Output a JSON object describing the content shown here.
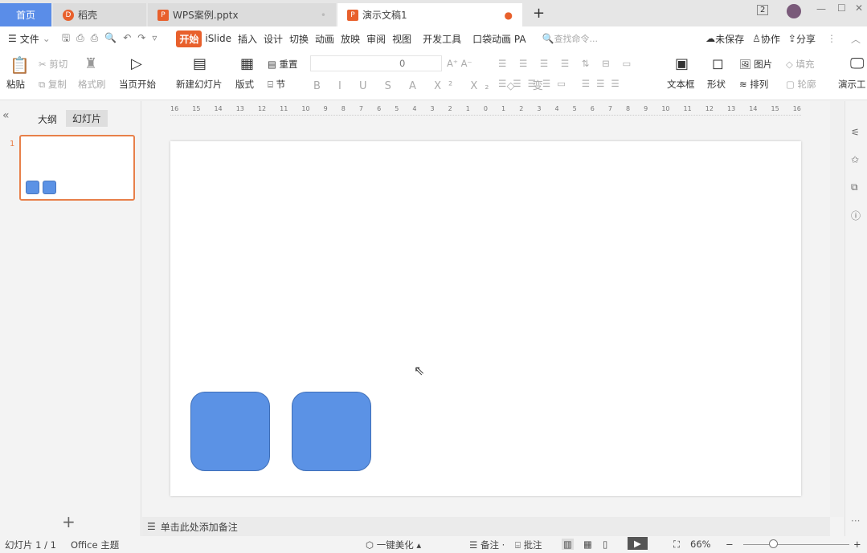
{
  "tabs": {
    "home": "首页",
    "daoke": "稻壳",
    "file1": "WPS案例.pptx",
    "file2": "演示文稿1",
    "new_tab": "+",
    "badge": "2"
  },
  "menu": {
    "file": "文件",
    "items": [
      "开始",
      "iSlide",
      "插入",
      "设计",
      "切换",
      "动画",
      "放映",
      "审阅",
      "视图",
      "开发工具",
      "口袋动画 PA"
    ],
    "search_placeholder": "查找命令...",
    "unsaved": "未保存",
    "collab": "协作",
    "share": "分享"
  },
  "ribbon": {
    "paste": "粘贴",
    "cut": "剪切",
    "copy": "复制",
    "format_painter": "格式刷",
    "play_from_current": "当页开始",
    "new_slide": "新建幻灯片",
    "layout": "版式",
    "reset": "重置",
    "section": "节",
    "font_size": "0",
    "textbox": "文本框",
    "shape": "形状",
    "picture": "图片",
    "fill": "填充",
    "arrange": "排列",
    "outline": "轮廓",
    "present_tools": "演示工"
  },
  "panel": {
    "outline_tab": "大纲",
    "slides_tab": "幻灯片",
    "slide_number": "1",
    "add": "+"
  },
  "ruler": [
    "16",
    "15",
    "14",
    "13",
    "12",
    "11",
    "10",
    "9",
    "8",
    "7",
    "6",
    "5",
    "4",
    "3",
    "2",
    "1",
    "0",
    "1",
    "2",
    "3",
    "4",
    "5",
    "6",
    "7",
    "8",
    "9",
    "10",
    "11",
    "12",
    "13",
    "14",
    "15",
    "16"
  ],
  "notes": {
    "placeholder": "单击此处添加备注"
  },
  "status": {
    "slide": "幻灯片 1 / 1",
    "theme": "Office 主题",
    "beautify": "一键美化",
    "notes": "备注",
    "comment": "批注",
    "zoom": "66%"
  },
  "colors": {
    "accent": "#e8602c",
    "shape": "#5b92e5",
    "home_tab": "#5a8de8"
  }
}
